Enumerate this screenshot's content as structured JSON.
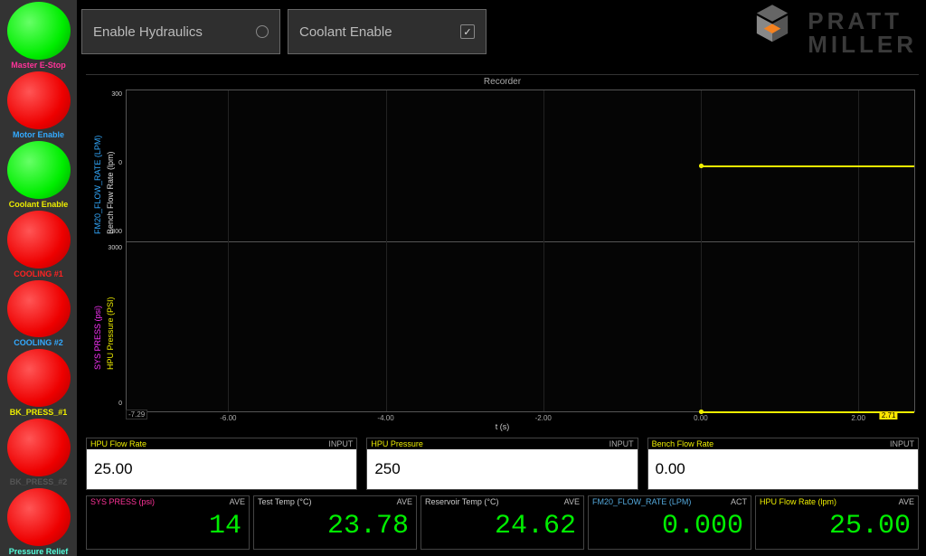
{
  "sidebar": {
    "items": [
      {
        "label": "Master E-Stop",
        "color": "green",
        "label_class": "lbl-pink"
      },
      {
        "label": "Motor Enable",
        "color": "red",
        "label_class": "lbl-blue"
      },
      {
        "label": "Coolant Enable",
        "color": "green",
        "label_class": "lbl-yellow"
      },
      {
        "label": "COOLING #1",
        "color": "red",
        "label_class": "lbl-red"
      },
      {
        "label": "COOLING #2",
        "color": "red",
        "label_class": "lbl-blue"
      },
      {
        "label": "BK_PRESS_#1",
        "color": "red",
        "label_class": "lbl-yellow"
      },
      {
        "label": "BK_PRESS_#2",
        "color": "red",
        "label_class": "lbl-dim"
      },
      {
        "label": "Pressure Relief",
        "color": "red",
        "label_class": "lbl-cyan"
      }
    ]
  },
  "topbar": {
    "btn1": {
      "label": "Enable Hydraulics",
      "checked": false
    },
    "btn2": {
      "label": "Coolant Enable",
      "checked": true
    }
  },
  "logo": {
    "line1": "PRATT",
    "line2": "MILLER"
  },
  "chart_data": {
    "type": "line",
    "title": "Recorder",
    "xlabel": "t (s)",
    "x_range": [
      -7.29,
      2.71
    ],
    "x_ticks": [
      -6.0,
      -4.0,
      -2.0,
      0.0,
      2.0
    ],
    "series": [
      {
        "name": "FM20_FLOW_RATE (LPM)",
        "color": "#3af",
        "axis": "left1",
        "range": [
          -300,
          300
        ],
        "data": [
          [
            0.0,
            0.0
          ],
          [
            2.71,
            0.0
          ]
        ]
      },
      {
        "name": "Bench Flow Rate (lpm)",
        "color": "#ee0",
        "axis": "left2",
        "range": [
          -300,
          300
        ],
        "data": [
          [
            0.0,
            0.0
          ],
          [
            2.71,
            0.0
          ]
        ]
      },
      {
        "name": "SYS PRESS (psi)",
        "color": "#f3f",
        "axis": "left3",
        "range": [
          0,
          3000
        ],
        "data": [
          [
            0.0,
            0.0
          ],
          [
            2.71,
            0.0
          ]
        ]
      },
      {
        "name": "HPU Pressure (PSI)",
        "color": "#ee0",
        "axis": "left4",
        "range": [
          0,
          3000
        ],
        "data": [
          [
            0.0,
            0.0
          ],
          [
            2.71,
            0.0
          ]
        ]
      }
    ]
  },
  "inputs": [
    {
      "name": "HPU Flow Rate",
      "tag": "INPUT",
      "value": "25.00"
    },
    {
      "name": "HPU Pressure",
      "tag": "INPUT",
      "value": "250"
    },
    {
      "name": "Bench Flow Rate",
      "tag": "INPUT",
      "value": "0.00"
    }
  ],
  "readouts": [
    {
      "name": "SYS PRESS (psi)",
      "name_class": "name-pink",
      "tag": "AVE",
      "value": "14"
    },
    {
      "name": "Test Temp (°C)",
      "name_class": "name-white",
      "tag": "AVE",
      "value": "23.78"
    },
    {
      "name": "Reservoir Temp (°C)",
      "name_class": "name-white",
      "tag": "AVE",
      "value": "24.62"
    },
    {
      "name": "FM20_FLOW_RATE (LPM)",
      "name_class": "name-cyan",
      "tag": "ACT",
      "value": "0.000"
    },
    {
      "name": "HPU Flow Rate (lpm)",
      "name_class": "name-yellow",
      "tag": "AVE",
      "value": "25.00"
    }
  ]
}
